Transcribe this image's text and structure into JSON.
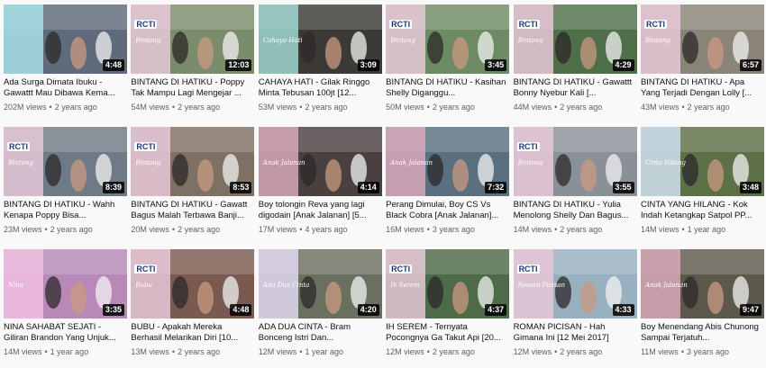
{
  "videos": [
    {
      "title": "Ada Surga Dimata Ibuku - Gawattt Mau Dibawa Kema...",
      "views": "202M views",
      "age": "2 years ago",
      "duration": "4:48",
      "bg": "#5f6b7a",
      "accent": "#a8e0e8",
      "logo": "",
      "show": ""
    },
    {
      "title": "BINTANG DI HATIKU - Poppy Tak Mampu Lagi Mengejar ...",
      "views": "54M views",
      "age": "2 years ago",
      "duration": "12:03",
      "bg": "#7b8c6c",
      "accent": "#e8c8d8",
      "logo": "RCTI",
      "show": "Bintang"
    },
    {
      "title": "CAHAYA HATI - Gilak Ringgo Minta Tebusan 100jt [12...",
      "views": "53M views",
      "age": "2 years ago",
      "duration": "3:09",
      "bg": "#3c3a36",
      "accent": "#9fd7d0",
      "logo": "",
      "show": "Cahaya Hati"
    },
    {
      "title": "BINTANG DI HATIKU - Kasihan Shelly Diganggu...",
      "views": "50M views",
      "age": "2 years ago",
      "duration": "3:45",
      "bg": "#6e8a64",
      "accent": "#e8c8d8",
      "logo": "RCTI",
      "show": "Bintang"
    },
    {
      "title": "BINTANG DI HATIKU - Gawattt Bonny Nyebur Kali [...",
      "views": "44M views",
      "age": "2 years ago",
      "duration": "4:29",
      "bg": "#4f6e4a",
      "accent": "#e8c8d8",
      "logo": "RCTI",
      "show": "Bintang"
    },
    {
      "title": "BINTANG DI HATIKU - Apa Yang Terjadi Dengan Lolly [...",
      "views": "43M views",
      "age": "2 years ago",
      "duration": "6:57",
      "bg": "#8a8478",
      "accent": "#e8c8d8",
      "logo": "RCTI",
      "show": "Bintang"
    },
    {
      "title": "BINTANG DI HATIKU - Wahh Kenapa Poppy Bisa...",
      "views": "23M views",
      "age": "2 years ago",
      "duration": "8:39",
      "bg": "#6f7a86",
      "accent": "#e8c8d8",
      "logo": "RCTI",
      "show": "Bintang"
    },
    {
      "title": "BINTANG DI HATIKU - Gawatt Bagus Malah Terbawa Banji...",
      "views": "20M views",
      "age": "2 years ago",
      "duration": "8:53",
      "bg": "#7e7062",
      "accent": "#e8c8d8",
      "logo": "RCTI",
      "show": "Bintang"
    },
    {
      "title": "Boy tolongin Reva yang lagi digodain [Anak Jalanan] [5...",
      "views": "17M views",
      "age": "4 years ago",
      "duration": "4:14",
      "bg": "#4a4040",
      "accent": "#d8a8b8",
      "logo": "",
      "show": "Anak Jalanan"
    },
    {
      "title": "Perang Dimulai, Boy CS Vs Black Cobra [Anak Jalanan]...",
      "views": "16M views",
      "age": "3 years ago",
      "duration": "7:32",
      "bg": "#5a6f80",
      "accent": "#d8a8b8",
      "logo": "",
      "show": "Anak Jalanan"
    },
    {
      "title": "BINTANG DI HATIKU - Yulia Menolong Shelly Dan Bagus...",
      "views": "14M views",
      "age": "2 years ago",
      "duration": "3:55",
      "bg": "#8a9098",
      "accent": "#e8c8d8",
      "logo": "RCTI",
      "show": "Bintang"
    },
    {
      "title": "CINTA YANG HILANG - Kok Indah Ketangkap Satpol PP...",
      "views": "14M views",
      "age": "1 year ago",
      "duration": "3:48",
      "bg": "#5e7048",
      "accent": "#d0e0f0",
      "logo": "",
      "show": "Cinta Hilang"
    },
    {
      "title": "NINA SAHABAT SEJATI - Giliran Brandon Yang Unjuk...",
      "views": "14M views",
      "age": "1 year ago",
      "duration": "3:35",
      "bg": "#b888b8",
      "accent": "#f0c0e0",
      "logo": "",
      "show": "Nina"
    },
    {
      "title": "BUBU - Apakah Mereka Berhasil Melarikan Diri [10...",
      "views": "13M views",
      "age": "2 years ago",
      "duration": "4:48",
      "bg": "#7a5a50",
      "accent": "#e8c8d8",
      "logo": "RCTI",
      "show": "Bubu"
    },
    {
      "title": "ADA DUA CINTA - Bram Bonceng Istri Dan...",
      "views": "12M views",
      "age": "1 year ago",
      "duration": "4:20",
      "bg": "#6a7060",
      "accent": "#e0d8f0",
      "logo": "",
      "show": "Ada Dua Cinta"
    },
    {
      "title": "IH SEREM - Ternyata Pocongnya Ga Takut Api [20...",
      "views": "12M views",
      "age": "2 years ago",
      "duration": "4:37",
      "bg": "#4e6a48",
      "accent": "#e8c8d8",
      "logo": "RCTI",
      "show": "Ih Serem"
    },
    {
      "title": "ROMAN PICISAN - Hah Gimana Ini [12 Mei 2017]",
      "views": "12M views",
      "age": "2 years ago",
      "duration": "4:33",
      "bg": "#98b0c0",
      "accent": "#e8c8d8",
      "logo": "RCTI",
      "show": "Roman Picisan"
    },
    {
      "title": "Boy Menendang Abis Chunong Sampai Terjatuh...",
      "views": "11M views",
      "age": "3 years ago",
      "duration": "9:47",
      "bg": "#5c584c",
      "accent": "#d8a8b8",
      "logo": "",
      "show": "Anak Jalanan"
    }
  ],
  "meta_separator": "•"
}
